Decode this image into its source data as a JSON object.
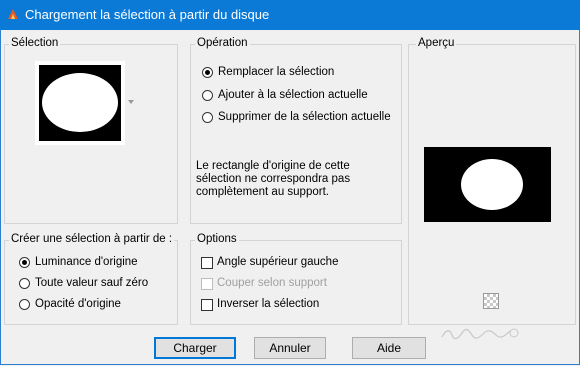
{
  "window": {
    "title": "Chargement la sélection à partir du disque"
  },
  "selection_group": {
    "label": "Sélection"
  },
  "operation_group": {
    "label": "Opération",
    "options": [
      "Remplacer la sélection",
      "Ajouter à la sélection actuelle",
      "Supprimer de la sélection actuelle"
    ],
    "selected_index": 0,
    "info": "Le rectangle d'origine de cette sélection ne correspondra pas complètement au support."
  },
  "preview_group": {
    "label": "Aperçu"
  },
  "create_group": {
    "label": "Créer une sélection à partir de :",
    "options": [
      "Luminance d'origine",
      "Toute valeur sauf zéro",
      "Opacité d'origine"
    ],
    "selected_index": 0
  },
  "options_group": {
    "label": "Options",
    "items": [
      {
        "label": "Angle supérieur gauche",
        "checked": false,
        "enabled": true
      },
      {
        "label": "Couper selon support",
        "checked": false,
        "enabled": false
      },
      {
        "label": "Inverser la sélection",
        "checked": false,
        "enabled": true
      }
    ]
  },
  "buttons": {
    "load": "Charger",
    "cancel": "Annuler",
    "help": "Aide"
  },
  "colors": {
    "titlebar": "#0a7ad6",
    "accent": "#0078d7"
  }
}
